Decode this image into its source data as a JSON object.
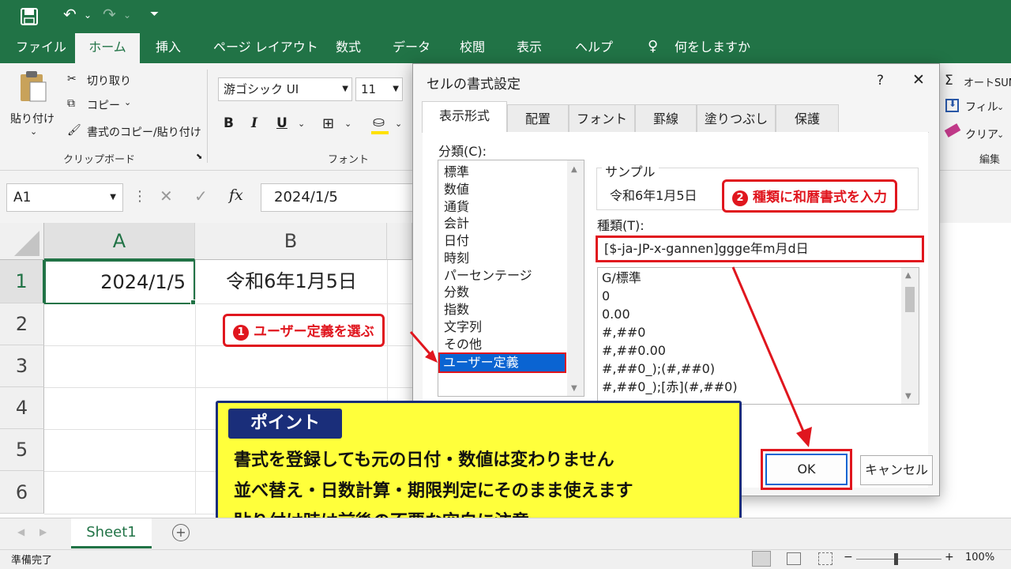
{
  "titlebar": {
    "undo_icon": "undo-icon",
    "redo_icon": "redo-icon",
    "save_icon": "save-icon"
  },
  "menu": {
    "items": [
      "ファイル",
      "ホーム",
      "挿入",
      "ページ レイアウト",
      "数式",
      "データ",
      "校閲",
      "表示",
      "ヘルプ"
    ],
    "tell_me": "何をしますか"
  },
  "ribbon": {
    "paste": "貼り付け",
    "cut": "切り取り",
    "copy": "コピー",
    "format_painter": "書式のコピー/貼り付け",
    "clipboard_group": "クリップボード",
    "font_name": "游ゴシック UI",
    "font_size": "11",
    "bold": "B",
    "italic": "I",
    "underline": "U",
    "font_group": "フォント",
    "autosum": "オートSUM",
    "fill": "フィル",
    "clear": "クリア",
    "edit_group": "編集"
  },
  "formula_bar": {
    "name_box": "A1",
    "fx": "fx",
    "value": "2024/1/5"
  },
  "sheet": {
    "columns": [
      "A",
      "B"
    ],
    "rows": [
      "1",
      "2",
      "3",
      "4",
      "5",
      "6"
    ],
    "cells": {
      "A1": "2024/1/5",
      "B1": "令和6年1月5日"
    }
  },
  "dialog": {
    "title": "セルの書式設定",
    "help": "?",
    "close": "✕",
    "tabs": [
      "表示形式",
      "配置",
      "フォント",
      "罫線",
      "塗りつぶし",
      "保護"
    ],
    "category_label": "分類(C):",
    "categories": [
      "標準",
      "数値",
      "通貨",
      "会計",
      "日付",
      "時刻",
      "パーセンテージ",
      "分数",
      "指数",
      "文字列",
      "その他",
      "ユーザー定義"
    ],
    "sample_label": "サンプル",
    "sample_value": "令和6年1月5日",
    "type_label": "種類(T):",
    "type_value": "[$-ja-JP-x-gannen]ggge年m月d日",
    "formats": [
      "G/標準",
      "0",
      "0.00",
      "#,##0",
      "#,##0.00",
      "#,##0_);(#,##0)",
      "#,##0_);[赤](#,##0)"
    ],
    "ok": "OK",
    "cancel": "キャンセル"
  },
  "callouts": {
    "step1_num": "1",
    "step1": "ユーザー定義を選ぶ",
    "step2_num": "2",
    "step2": "種類に和暦書式を入力"
  },
  "note": {
    "title": "ポイント",
    "lines": [
      "書式を登録しても元の日付・数値は変わりません",
      "並べ替え・日数計算・期限判定にそのまま使えます",
      "貼り付け時は前後の不要な空白に注意"
    ]
  },
  "sheet_tab": "Sheet1",
  "status": {
    "ready": "準備完了",
    "zoom": "100%"
  },
  "colors": {
    "excel_green": "#217346",
    "callout_red": "#e0161e",
    "note_yellow": "#ffff3b",
    "note_navy": "#1a2e7a",
    "selection_blue": "#0a64d2"
  }
}
